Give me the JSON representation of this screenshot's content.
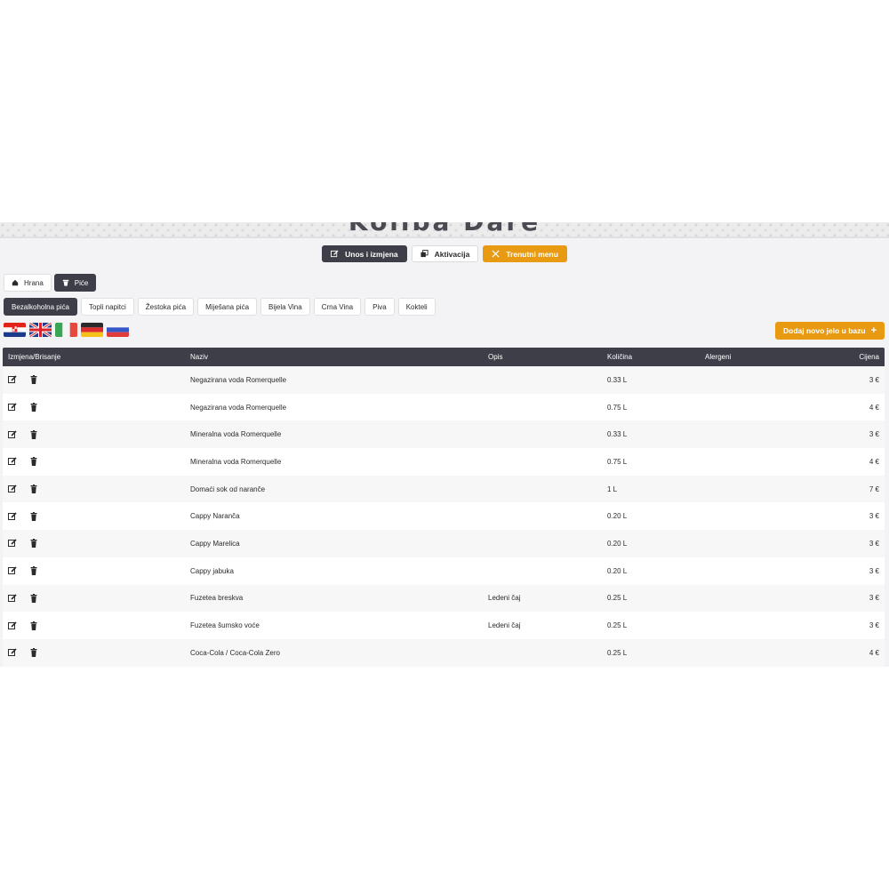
{
  "header": {
    "title": "Koliba Dare"
  },
  "top_buttons": [
    {
      "label": "Unos i izmjena",
      "icon": "edit-icon"
    },
    {
      "label": "Aktivacija",
      "icon": "copy-icon"
    },
    {
      "label": "Trenutni menu",
      "icon": "cutlery-icon"
    }
  ],
  "categories": [
    {
      "label": "Hrana",
      "icon": "home-icon",
      "active": false
    },
    {
      "label": "Piće",
      "icon": "glass-icon",
      "active": true
    }
  ],
  "subcategories": [
    "Bezalkoholna pića",
    "Topli napitci",
    "Žestoka pića",
    "Miješana pića",
    "Bijela Vina",
    "Crna Vina",
    "Piva",
    "Kokteli"
  ],
  "languages": [
    "hr",
    "en",
    "it",
    "de",
    "ru"
  ],
  "add_button": {
    "label": "Dodaj novo jelo u bazu",
    "icon": "plus-icon"
  },
  "table": {
    "columns": [
      "Izmjena/Brisanje",
      "Naziv",
      "Opis",
      "Količina",
      "Alergeni",
      "Cijena"
    ],
    "rows": [
      {
        "name": "Negazirana voda Romerquelle",
        "desc": "",
        "qty": "0.33 L",
        "allergens": "",
        "price": "3 €"
      },
      {
        "name": "Negazirana voda Romerquelle",
        "desc": "",
        "qty": "0.75 L",
        "allergens": "",
        "price": "4 €"
      },
      {
        "name": "Mineralna voda Romerquelle",
        "desc": "",
        "qty": "0.33 L",
        "allergens": "",
        "price": "3 €"
      },
      {
        "name": "Mineralna voda Romerquelle",
        "desc": "",
        "qty": "0.75 L",
        "allergens": "",
        "price": "4 €"
      },
      {
        "name": "Domaći sok od naranče",
        "desc": "",
        "qty": "1 L",
        "allergens": "",
        "price": "7 €"
      },
      {
        "name": "Cappy Naranča",
        "desc": "",
        "qty": "0.20 L",
        "allergens": "",
        "price": "3 €"
      },
      {
        "name": "Cappy Marelica",
        "desc": "",
        "qty": "0.20 L",
        "allergens": "",
        "price": "3 €"
      },
      {
        "name": "Cappy jabuka",
        "desc": "",
        "qty": "0.20 L",
        "allergens": "",
        "price": "3 €"
      },
      {
        "name": "Fuzetea breskva",
        "desc": "Ledeni čaj",
        "qty": "0.25 L",
        "allergens": "",
        "price": "3 €"
      },
      {
        "name": "Fuzetea šumsko voće",
        "desc": "Ledeni čaj",
        "qty": "0.25 L",
        "allergens": "",
        "price": "3 €"
      },
      {
        "name": "Coca-Cola / Coca-Cola Zero",
        "desc": "",
        "qty": "0.25 L",
        "allergens": "",
        "price": "4 €"
      }
    ]
  },
  "colors": {
    "dark": "#3d3e48",
    "accent": "#e89b12",
    "background": "#f3f3f5"
  }
}
